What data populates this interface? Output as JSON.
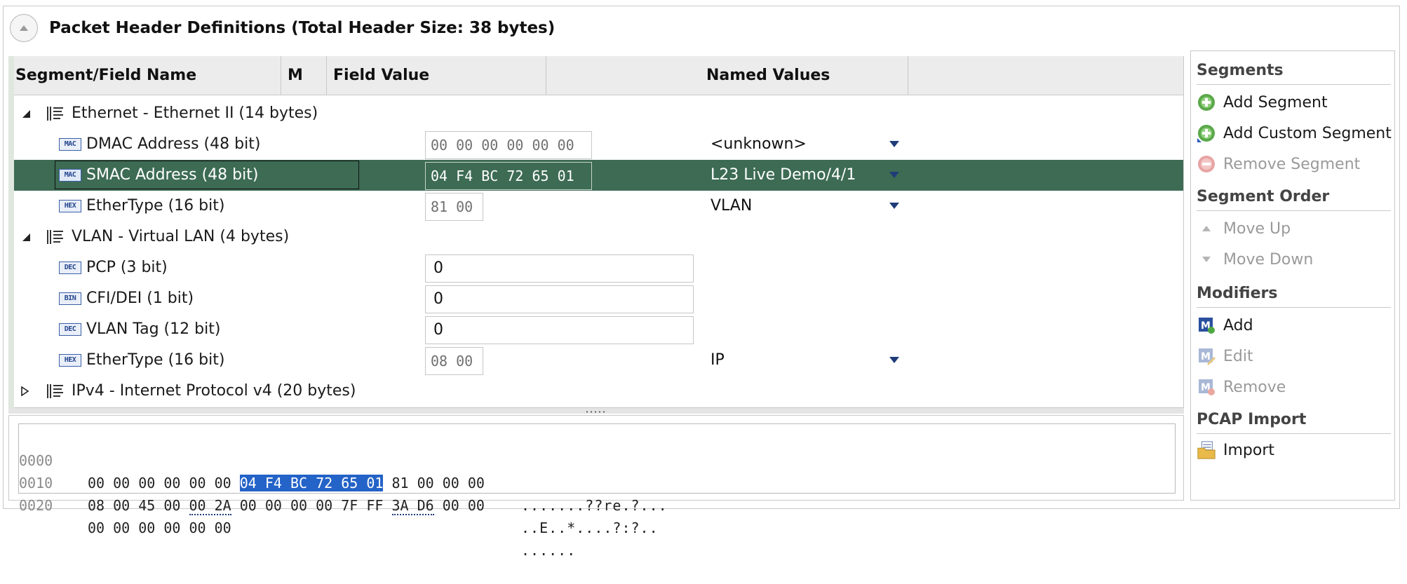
{
  "section": {
    "title": "Packet Header Definitions (Total Header Size: 38 bytes)"
  },
  "columns": {
    "name": "Segment/Field Name",
    "m": "M",
    "value": "Field Value",
    "named": "Named Values"
  },
  "rows": [
    {
      "kind": "segment",
      "expanded": true,
      "label": "Ethernet - Ethernet II (14 bytes)"
    },
    {
      "kind": "field",
      "icon": "MAC",
      "label": "DMAC Address (48 bit)",
      "value": "00 00 00 00 00 00",
      "named": "<unknown>"
    },
    {
      "kind": "field",
      "icon": "MAC",
      "label": "SMAC Address (48 bit)",
      "value": "04 F4 BC 72 65 01",
      "named": "L23 Live Demo/4/1",
      "selected": true
    },
    {
      "kind": "field",
      "icon": "HEX",
      "label": "EtherType (16 bit)",
      "value": "81 00",
      "named": "VLAN"
    },
    {
      "kind": "segment",
      "expanded": true,
      "label": "VLAN - Virtual LAN (4 bytes)"
    },
    {
      "kind": "field",
      "icon": "DEC",
      "label": "PCP (3 bit)",
      "value": "0"
    },
    {
      "kind": "field",
      "icon": "BIN",
      "label": "CFI/DEI (1 bit)",
      "value": "0"
    },
    {
      "kind": "field",
      "icon": "DEC",
      "label": "VLAN Tag (12 bit)",
      "value": "0"
    },
    {
      "kind": "field",
      "icon": "HEX",
      "label": "EtherType (16 bit)",
      "value": "08 00",
      "named": "IP"
    },
    {
      "kind": "segment",
      "expanded": false,
      "label": "IPv4 - Internet Protocol v4 (20 bytes)"
    }
  ],
  "hex": {
    "lines": [
      {
        "offset": "0000",
        "pre": "00 00 00 00 00 00 ",
        "hl": "04 F4 BC 72 65 01",
        "post": " 81 00 00 00",
        "ascii": ".......??re.?..."
      },
      {
        "offset": "0010",
        "b1": "08 00 45 00 ",
        "u1": "00 2A",
        "b2": " 00 00 00 00 7F FF ",
        "u2": "3A D6",
        "b3": " 00 00",
        "ascii": "..E..*....?:?.."
      },
      {
        "offset": "0020",
        "pre": "00 00 00 00 00 00",
        "ascii": "......"
      }
    ]
  },
  "sidebar": {
    "segments": {
      "title": "Segments",
      "add": "Add Segment",
      "add_custom": "Add Custom Segment",
      "remove": "Remove Segment"
    },
    "order": {
      "title": "Segment Order",
      "up": "Move Up",
      "down": "Move Down"
    },
    "modifiers": {
      "title": "Modifiers",
      "add": "Add",
      "edit": "Edit",
      "remove": "Remove"
    },
    "pcap": {
      "title": "PCAP Import",
      "import": "Import"
    }
  },
  "colors": {
    "selected_row": "#3d6b54",
    "hex_highlight": "#2463c7",
    "dropdown_arrow": "#1f3c78"
  }
}
